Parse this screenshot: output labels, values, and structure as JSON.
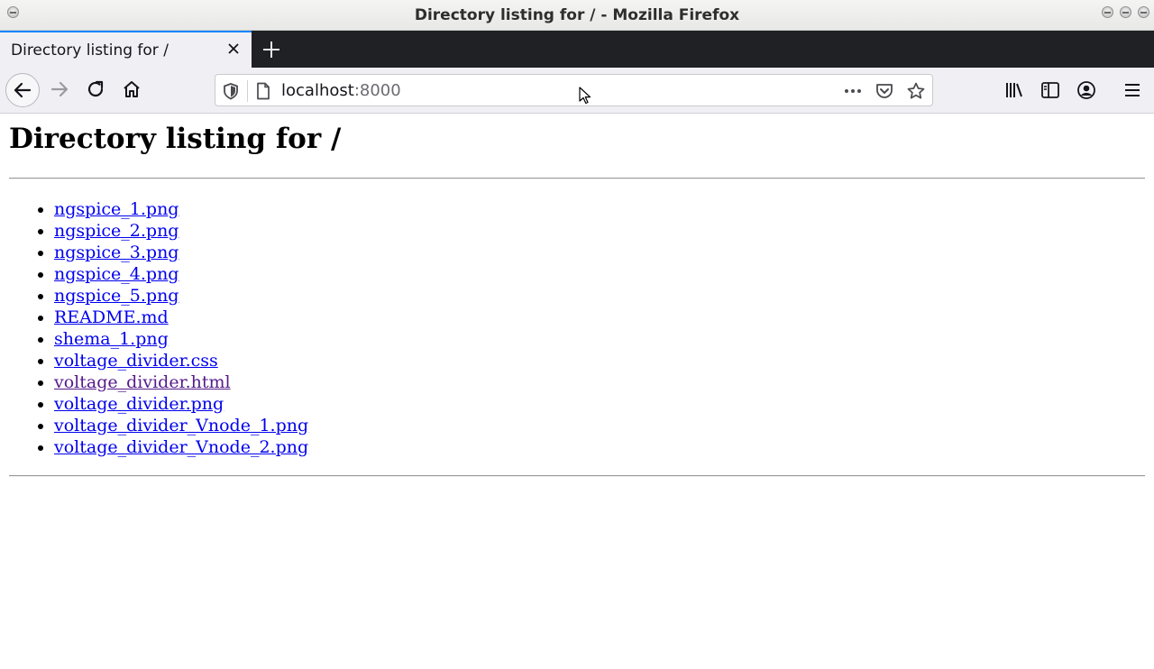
{
  "window": {
    "title": "Directory listing for / - Mozilla Firefox"
  },
  "tabs": [
    {
      "label": "Directory listing for /"
    }
  ],
  "urlbar": {
    "host": "localhost",
    "port": ":8000"
  },
  "icons": {
    "back": "back-arrow-icon",
    "forward": "forward-arrow-icon",
    "reload": "reload-icon",
    "home": "home-icon",
    "shield": "tracking-protection-shield-icon",
    "page": "page-icon",
    "more": "more-actions-icon",
    "pocket": "pocket-icon",
    "bookmark": "bookmark-star-icon",
    "library": "library-icon",
    "sidebar": "sidebar-icon",
    "account": "account-icon",
    "menu": "hamburger-menu-icon"
  },
  "page": {
    "heading": "Directory listing for /",
    "files": [
      {
        "name": "ngspice_1.png",
        "visited": false
      },
      {
        "name": "ngspice_2.png",
        "visited": false
      },
      {
        "name": "ngspice_3.png",
        "visited": false
      },
      {
        "name": "ngspice_4.png",
        "visited": false
      },
      {
        "name": "ngspice_5.png",
        "visited": false
      },
      {
        "name": "README.md",
        "visited": false
      },
      {
        "name": "shema_1.png",
        "visited": false
      },
      {
        "name": "voltage_divider.css",
        "visited": false
      },
      {
        "name": "voltage_divider.html",
        "visited": true
      },
      {
        "name": "voltage_divider.png",
        "visited": false
      },
      {
        "name": "voltage_divider_Vnode_1.png",
        "visited": false
      },
      {
        "name": "voltage_divider_Vnode_2.png",
        "visited": false
      }
    ]
  },
  "colors": {
    "link": "#0000ee",
    "visited_link": "#551a8b",
    "tab_strip": "#1f2124",
    "toolbar": "#f0f0f4",
    "accent": "#0a84ff"
  }
}
